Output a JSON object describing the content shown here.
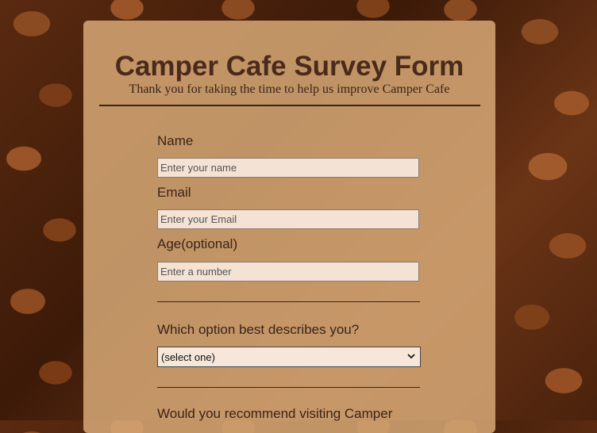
{
  "form": {
    "title": "Camper Cafe Survey Form",
    "subtitle": "Thank you for taking the time to help us improve Camper Cafe",
    "fields": {
      "name": {
        "label": "Name",
        "placeholder": "Enter your name"
      },
      "email": {
        "label": "Email",
        "placeholder": "Enter your Email"
      },
      "age": {
        "label": "Age(optional)",
        "placeholder": "Enter a number"
      }
    },
    "describe": {
      "question": "Which option best describes you?",
      "selected": "(select one)"
    },
    "recommend": {
      "question": "Would you recommend visiting Camper"
    }
  },
  "icons": {
    "select_arrow": "chevron-down-icon"
  },
  "colors": {
    "card_background": "#d6a876",
    "title_text": "#4a2a1a",
    "body_text": "#3a2418"
  }
}
